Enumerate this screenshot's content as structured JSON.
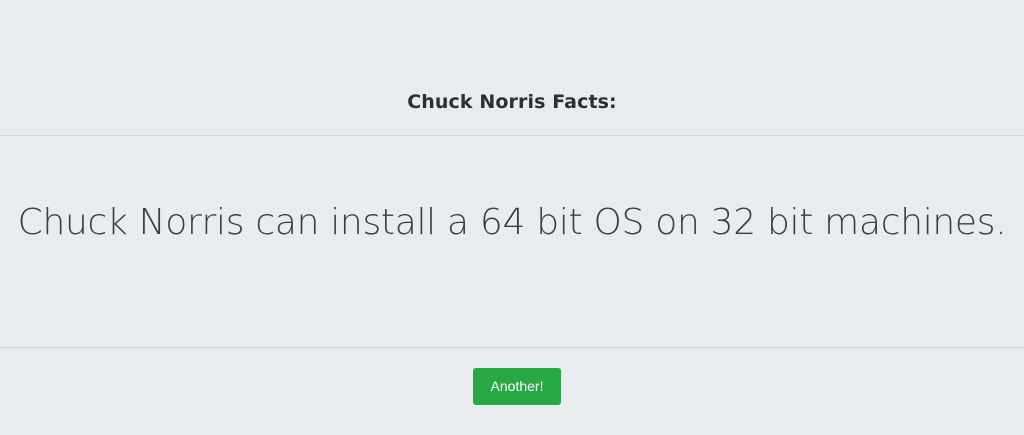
{
  "header": {
    "title": "Chuck Norris Facts:"
  },
  "fact": {
    "text": "Chuck Norris can install a 64 bit OS on 32 bit machines."
  },
  "actions": {
    "another_label": "Another!"
  },
  "colors": {
    "background": "#e9ecef",
    "button": "#28a745",
    "button_text": "#ffffff",
    "divider": "#d3d6da"
  }
}
